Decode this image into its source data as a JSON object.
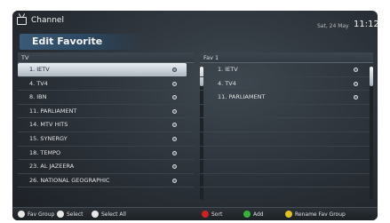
{
  "header": {
    "section_title": "Channel",
    "date": "Sat, 24 May",
    "time": "11:12",
    "icon": "tv-icon"
  },
  "page_title": "Edit Favorite",
  "left_pane": {
    "title": "TV",
    "selected_index": 0,
    "items": [
      "1. IETV",
      "4. TV4",
      "8. IBN",
      "11. PARLIAMENT",
      "14. MTV HITS",
      "15. SYNERGY",
      "18. TEMPO",
      "23. AL JAZEERA",
      "26. NATIONAL GEOGRAPHIC"
    ]
  },
  "right_pane": {
    "title": "Fav 1",
    "items": [
      "1. IETV",
      "4. TV4",
      "11. PARLIAMENT"
    ]
  },
  "bottom_bar": {
    "fav_group": "Fav Group",
    "select": "Select",
    "select_all": "Select All",
    "sort": "Sort",
    "add": "Add",
    "rename": "Rename Fav Group"
  },
  "colors": {
    "red": "#d02020",
    "green": "#36b53a",
    "yellow": "#e0c21a"
  }
}
